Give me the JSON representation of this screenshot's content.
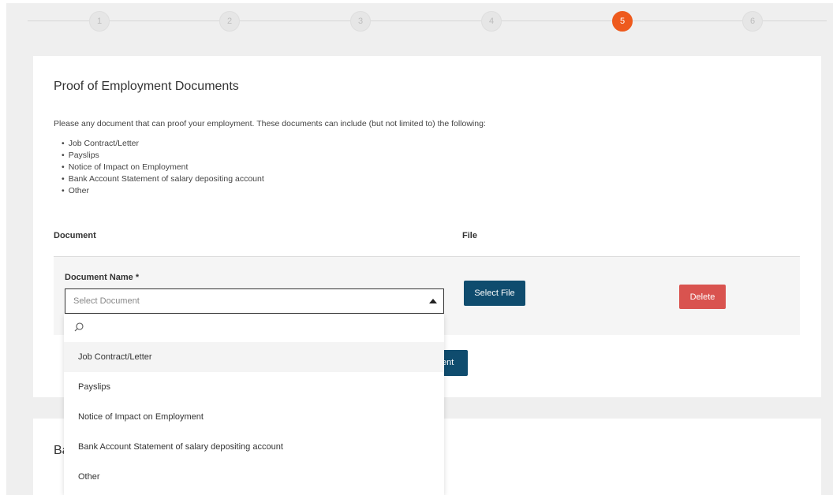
{
  "stepper": {
    "steps": [
      {
        "label": "1",
        "active": false
      },
      {
        "label": "2",
        "active": false
      },
      {
        "label": "3",
        "active": false
      },
      {
        "label": "4",
        "active": false
      },
      {
        "label": "5",
        "active": true
      },
      {
        "label": "6",
        "active": false
      }
    ],
    "active_color": "#ee5a1d"
  },
  "section": {
    "title": "Proof of Employment Documents",
    "intro": "Please any document that can proof your employment. These documents can include (but not limited to) the following:",
    "doc_types": [
      "Job Contract/Letter",
      "Payslips",
      "Notice of Impact on Employment",
      "Bank Account Statement of salary depositing account",
      "Other"
    ],
    "table": {
      "col_document": "Document",
      "col_file": "File"
    },
    "row": {
      "field_label": "Document Name *",
      "placeholder": "Select Document",
      "select_file_label": "Select File",
      "delete_label": "Delete"
    },
    "add_button_visible_text": "ent"
  },
  "next_section": {
    "title_visible": "Ba"
  },
  "dropdown": {
    "search_icon": "search-icon",
    "options": [
      "Job Contract/Letter",
      "Payslips",
      "Notice of Impact on Employment",
      "Bank Account Statement of salary depositing account",
      "Other"
    ],
    "highlighted_index": 0
  },
  "colors": {
    "primary_button": "#0f4c6e",
    "danger_button": "#d9534f",
    "background": "#efefef"
  }
}
